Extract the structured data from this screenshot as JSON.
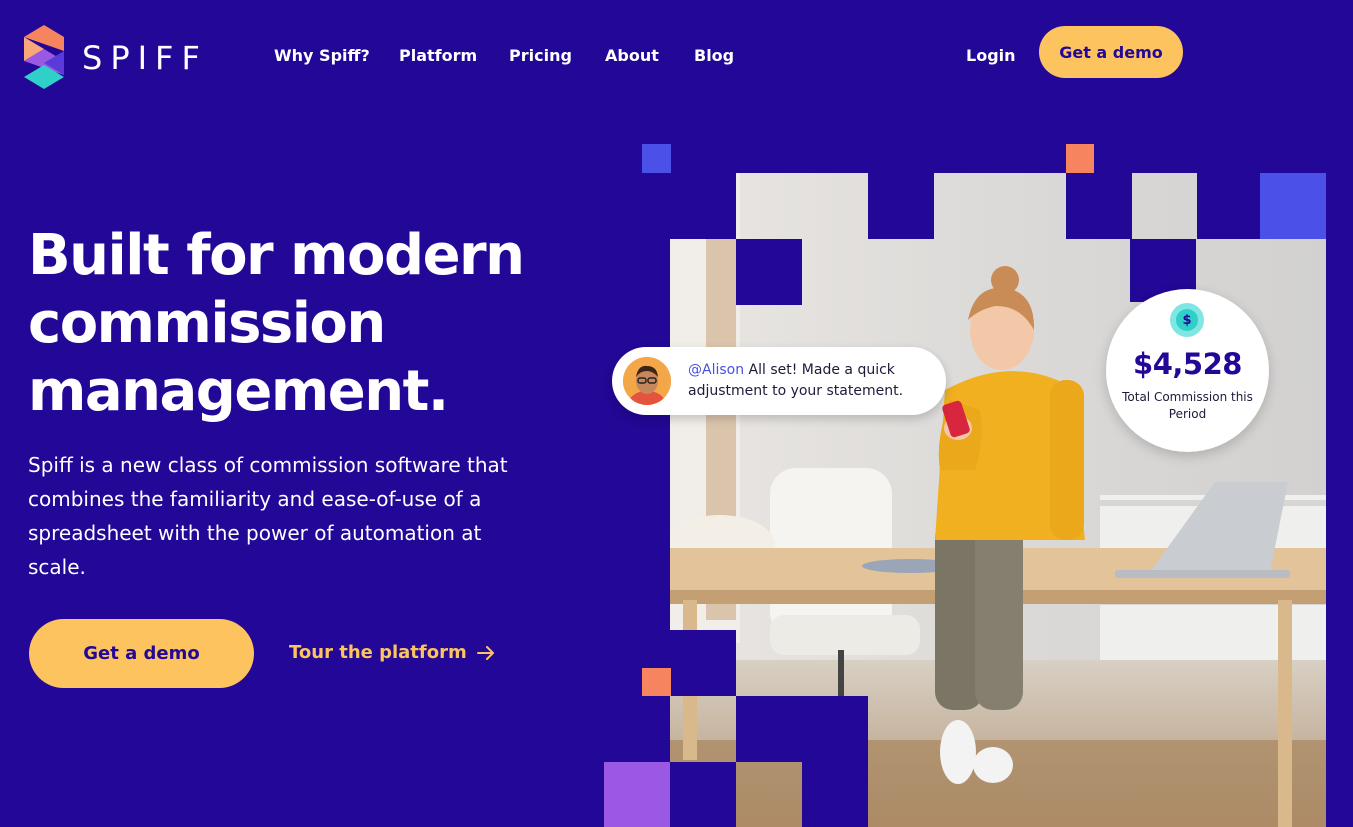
{
  "brand": {
    "name": "SPIFF",
    "colors": {
      "background": "#230796",
      "accent": "#fcc35f",
      "logo_orange": "#f6845f",
      "logo_purple": "#9b59e3",
      "logo_teal": "#2ed0c8",
      "pixel_blue": "#4a50e8",
      "pixel_coral": "#f6845f"
    }
  },
  "nav": {
    "items": [
      {
        "label": "Why Spiff?"
      },
      {
        "label": "Platform"
      },
      {
        "label": "Pricing"
      },
      {
        "label": "About"
      },
      {
        "label": "Blog"
      }
    ],
    "login_label": "Login",
    "cta_label": "Get a demo"
  },
  "hero": {
    "title": "Built for modern commission management.",
    "description": "Spiff is a new class of commission software that combines the familiarity and ease-of-use of a spreadsheet with the power of automation at scale.",
    "cta_label": "Get a demo",
    "tour_label": "Tour the platform",
    "tour_icon": "arrow-right-icon"
  },
  "chat": {
    "mention": "@Alison",
    "message": " All set! Made a quick adjustment to your statement.",
    "avatar_icon": "avatar-man-icon"
  },
  "commission": {
    "icon": "dollar-icon",
    "icon_glyph": "$",
    "amount": "$4,528",
    "label": "Total Commission this Period"
  }
}
